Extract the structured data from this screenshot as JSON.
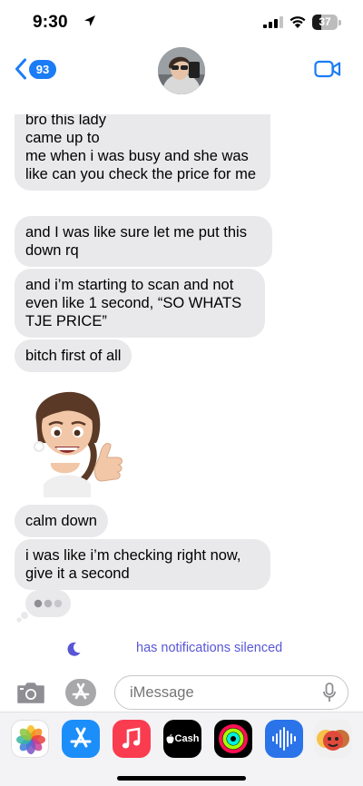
{
  "status_bar": {
    "time": "9:30",
    "battery_level": "37",
    "battery_fraction": 0.37
  },
  "header": {
    "unread_count": "93",
    "icons": [
      "chevron-left-icon",
      "avatar",
      "video-camera-icon"
    ]
  },
  "messages": [
    {
      "text": "bro this lady\ncame up to\nme when i was busy and she was like can you check the price for me"
    },
    {
      "text": "and I was like sure let me put this down rq"
    },
    {
      "text": "and i’m starting to scan and not even like 1 second, “SO WHATS TJE PRICE”"
    },
    {
      "text": "bitch first of all"
    },
    {
      "text": "calm down"
    },
    {
      "text": "i was like i’m checking right now, give it a second"
    }
  ],
  "silenced_notice": "has notifications silenced",
  "input": {
    "placeholder": "iMessage"
  },
  "app_drawer": {
    "apps": [
      {
        "name": "photos",
        "color": "#ffffff"
      },
      {
        "name": "app-store",
        "color": "#1c8ef9"
      },
      {
        "name": "music",
        "color": "#fa3c50"
      },
      {
        "name": "apple-cash",
        "label": "Cash",
        "color": "#000000"
      },
      {
        "name": "fitness",
        "color": "#000000"
      },
      {
        "name": "audio-message",
        "color": "#2b73e8"
      },
      {
        "name": "memoji",
        "color": "#f0f0f0"
      }
    ]
  },
  "colors": {
    "accent": "#1b7cf5",
    "bubble_received": "#e9e9eb",
    "silenced": "#5856d6"
  }
}
